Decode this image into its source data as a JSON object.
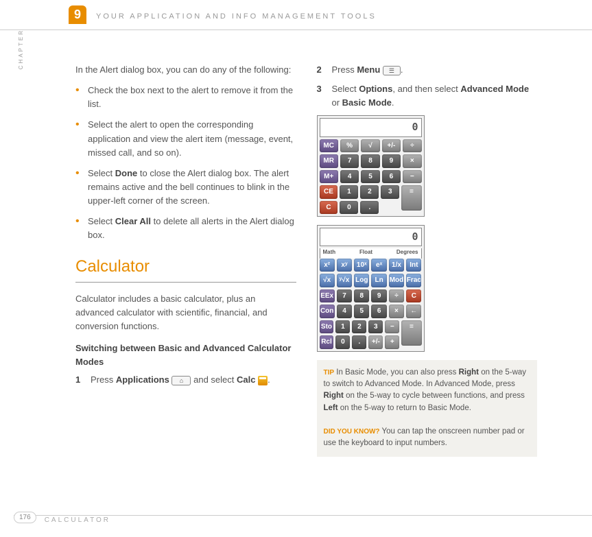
{
  "header": {
    "chapter_num": "9",
    "title": "YOUR APPLICATION AND INFO MANAGEMENT TOOLS",
    "chapter_label": "CHAPTER"
  },
  "left": {
    "intro": "In the Alert dialog box, you can do any of the following:",
    "bullets": [
      {
        "text": "Check the box next to the alert to remove it from the list."
      },
      {
        "text": "Select the alert to open the corresponding application and view the alert item (message, event, missed call, and so on)."
      },
      {
        "pre": "Select ",
        "bold1": "Done",
        "post": " to close the Alert dialog box. The alert remains active and the bell continues to blink in the upper-left corner of the screen."
      },
      {
        "pre": "Select ",
        "bold1": "Clear All",
        "post": " to delete all alerts in the Alert dialog box."
      }
    ],
    "section": "Calculator",
    "section_desc": "Calculator includes a basic calculator, plus an advanced calculator with scientific, financial, and conversion functions.",
    "subhead": "Switching between Basic and Advanced Calculator Modes",
    "step1": {
      "num": "1",
      "pre": "Press ",
      "b1": "Applications",
      "mid": " and select ",
      "b2": "Calc",
      "post": "."
    }
  },
  "right": {
    "step2": {
      "num": "2",
      "pre": "Press ",
      "b1": "Menu",
      "post": "."
    },
    "step3": {
      "num": "3",
      "pre": "Select ",
      "b1": "Options",
      "mid1": ", and then select ",
      "b2": "Advanced Mode",
      "mid2": " or ",
      "b3": "Basic Mode",
      "post": "."
    },
    "basic_calc": {
      "display": "0",
      "rows": [
        [
          "MC",
          "%",
          "√",
          "+/-",
          "÷"
        ],
        [
          "MR",
          "7",
          "8",
          "9",
          "×"
        ],
        [
          "M+",
          "4",
          "5",
          "6",
          "−"
        ],
        [
          "CE",
          "1",
          "2",
          "3"
        ],
        [
          "C",
          "0",
          ".",
          "="
        ]
      ]
    },
    "adv_calc": {
      "display": "0",
      "modes": [
        "Math",
        "Float",
        "Degrees"
      ],
      "rows": [
        [
          "x²",
          "xʸ",
          "10ˣ",
          "eˣ",
          "1/x",
          "Int"
        ],
        [
          "√x",
          "ʸ√x",
          "Log",
          "Ln",
          "Mod",
          "Frac"
        ],
        [
          "EEx",
          "7",
          "8",
          "9",
          "÷",
          "C"
        ],
        [
          "Con",
          "4",
          "5",
          "6",
          "×",
          "←"
        ],
        [
          "Sto",
          "1",
          "2",
          "3",
          "−"
        ],
        [
          "Rcl",
          "0",
          ".",
          "+/-",
          "+",
          "="
        ]
      ]
    },
    "tip": {
      "label": "TIP",
      "text1": "In Basic Mode, you can also press ",
      "b1": "Right",
      "text2": " on the 5-way to switch to Advanced Mode. In Advanced Mode, press ",
      "b2": "Right",
      "text3": " on the 5-way to cycle between functions, and press ",
      "b3": "Left",
      "text4": " on the 5-way to return to Basic Mode."
    },
    "dyk": {
      "label": "DID YOU KNOW?",
      "text": "You can tap the onscreen number pad or use the keyboard to input numbers."
    }
  },
  "footer": {
    "page": "176",
    "section": "CALCULATOR"
  }
}
